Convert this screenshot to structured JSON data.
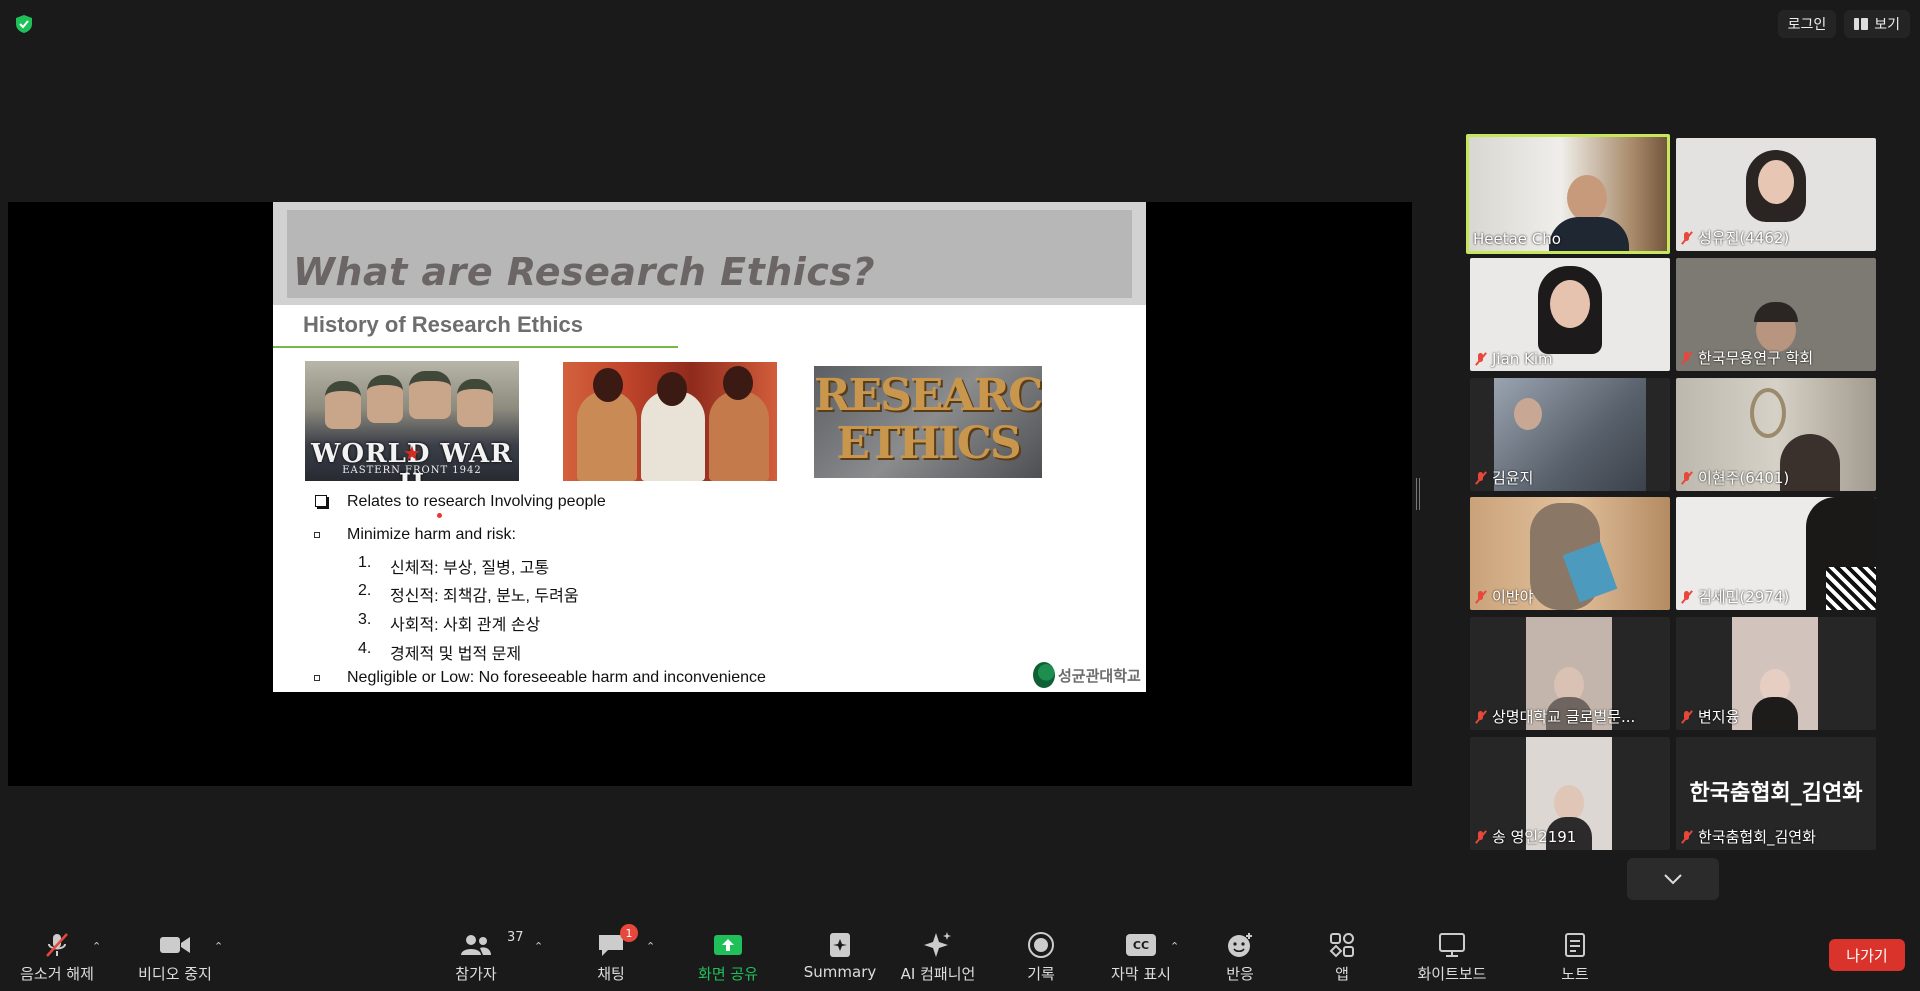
{
  "top": {
    "login_label": "로그인",
    "view_label": "보기"
  },
  "slide": {
    "title": "What are Research Ethics?",
    "subtitle": "History of Research Ethics",
    "images": {
      "ww2_text": "WORLD WAR II",
      "ww2_sub": "EASTERN FRONT 1942",
      "ethics_line1": "RESEARCH",
      "ethics_line2": "ETHICS"
    },
    "bullets": {
      "b1": "Relates to research Involving people",
      "b2": "Minimize harm and risk:",
      "n1": "1.",
      "i1": "신체적: 부상, 질병, 고통",
      "n2": "2.",
      "i2": "정신적: 죄책감, 분노, 두려움",
      "n3": "3.",
      "i3": "사회적: 사회 관계 손상",
      "n4": "4.",
      "i4": "경제적 및 법적 문제",
      "b3": "Negligible or Low: No foreseeable harm and inconvenience"
    },
    "logo_text": "성균관대학교"
  },
  "participants": {
    "p1": "Heetae Cho",
    "p2": "성유진(4462)",
    "p3": "Jian Kim",
    "p4": "한국무용연구 학회",
    "p5": "김윤지",
    "p6": "이현주(6401)",
    "p7": "이반야",
    "p8": "김세민(2974)",
    "p9": "상명대학교 글로벌문...",
    "p10": "변지융",
    "p11": "송 영인2191",
    "p12_big": "한국춤협회_김연화",
    "p12": "한국춤협회_김연화"
  },
  "toolbar": {
    "unmute": "음소거 해제",
    "video": "비디오 중지",
    "participants": "참가자",
    "participants_count": "37",
    "chat": "채팅",
    "chat_badge": "1",
    "share": "화면 공유",
    "summary": "Summary",
    "ai": "AI 컴패니언",
    "record": "기록",
    "cc": "자막 표시",
    "cc_icon": "CC",
    "reactions": "반응",
    "apps": "앱",
    "whiteboard": "화이트보드",
    "notes": "노트",
    "leave": "나가기"
  },
  "colors": {
    "accent_green": "#1fc05a",
    "active_border": "#c6e65b",
    "leave_red": "#d9332b",
    "muted_red": "#e8473b"
  }
}
